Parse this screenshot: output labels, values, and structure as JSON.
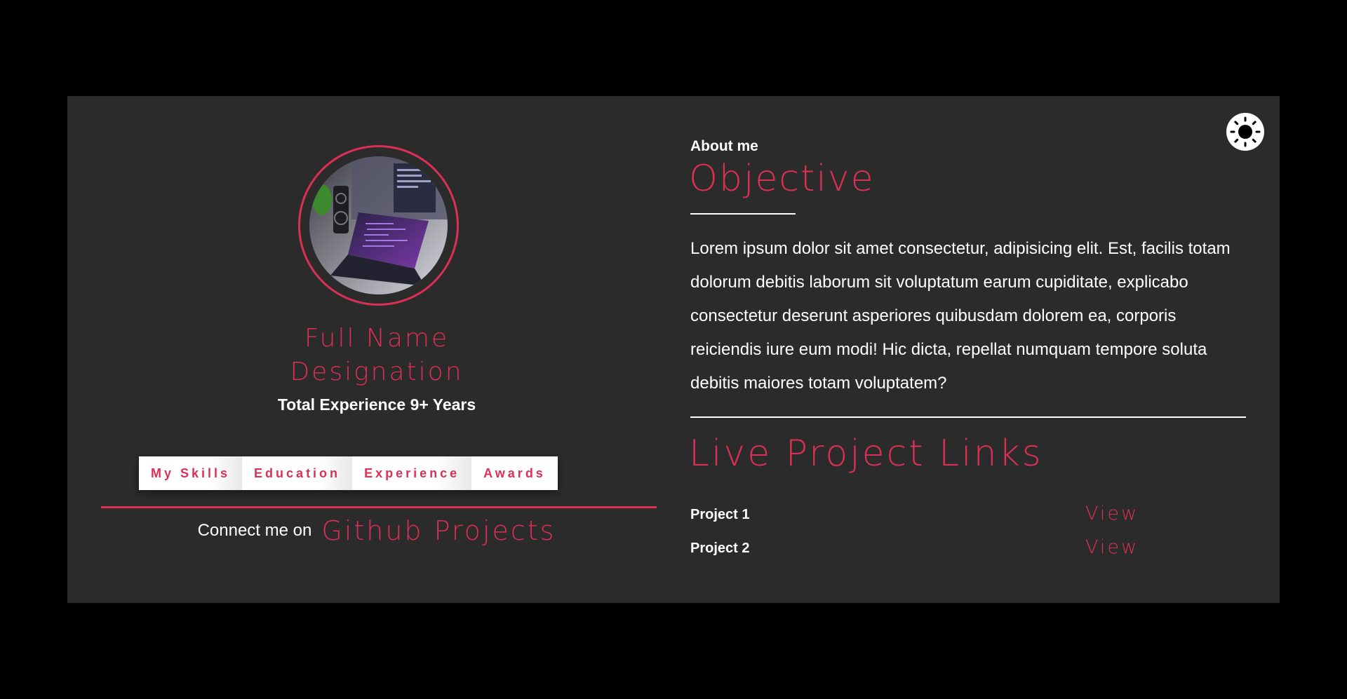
{
  "theme_toggle": {
    "icon": "sun-icon"
  },
  "profile": {
    "full_name": "Full Name",
    "designation": "Designation",
    "total_experience": "Total Experience 9+ Years"
  },
  "tabs": [
    {
      "label": "My Skills"
    },
    {
      "label": "Education"
    },
    {
      "label": "Experience"
    },
    {
      "label": "Awards"
    }
  ],
  "connect": {
    "label": "Connect me on",
    "link_label": "Github Projects"
  },
  "about": {
    "label": "About me",
    "title": "Objective",
    "text": "Lorem ipsum dolor sit amet consectetur, adipisicing elit. Est, facilis totam dolorum debitis laborum sit voluptatum earum cupiditate, explicabo consectetur deserunt asperiores quibusdam dolorem ea, corporis reiciendis iure eum modi! Hic dicta, repellat numquam tempore soluta debitis maiores totam voluptatem?"
  },
  "projects": {
    "title": "Live Project Links",
    "items": [
      {
        "name": "Project 1",
        "link_label": "View"
      },
      {
        "name": "Project 2",
        "link_label": "View"
      }
    ]
  },
  "colors": {
    "accent": "#dc2f55",
    "card_background": "#2b2b2b",
    "page_background": "#000000",
    "text": "#ffffff"
  }
}
